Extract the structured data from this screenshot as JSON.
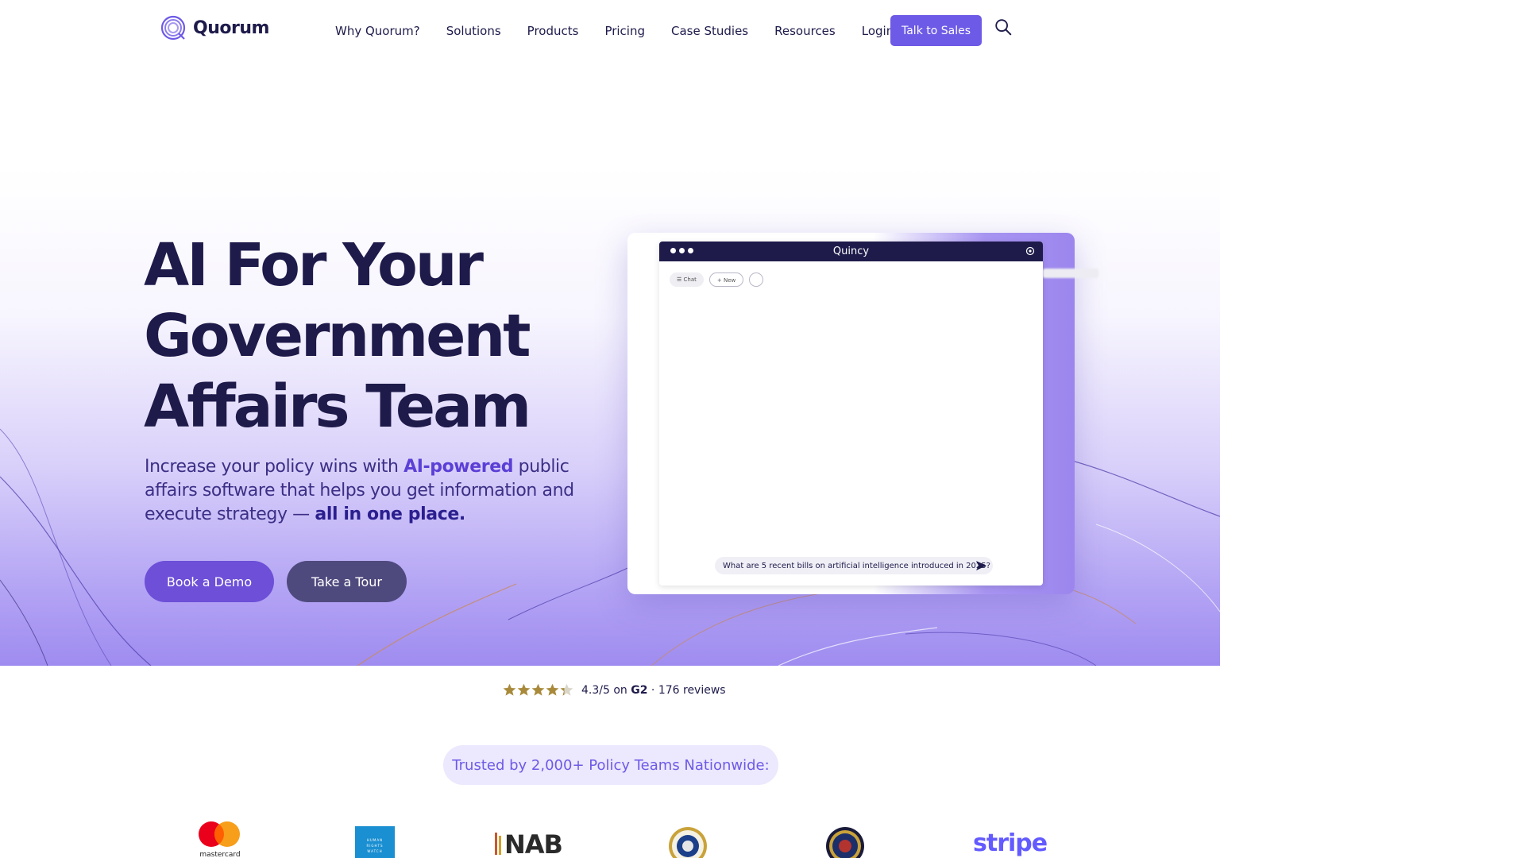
{
  "brand": {
    "name": "Quorum"
  },
  "nav": {
    "links": [
      "Why Quorum?",
      "Solutions",
      "Products",
      "Pricing",
      "Case Studies",
      "Resources",
      "Login"
    ],
    "cta_label": "Talk to Sales",
    "search_icon": "search-icon"
  },
  "hero": {
    "headline_lines": [
      "AI For Your",
      "Government",
      "Affairs Team"
    ],
    "subhead": {
      "part1": "Increase your policy wins with ",
      "highlight1": "AI-powered",
      "part2": " public affairs software that helps you get information and execute strategy — ",
      "highlight2": "all in one place."
    },
    "primary_button": "Book a Demo",
    "secondary_button": "Take a Tour"
  },
  "mockup": {
    "window_title": "Quincy",
    "chat_label": "Chat",
    "new_label": "+ New",
    "prompt": "What are 5 recent bills on artificial intelligence introduced in 2025?"
  },
  "rating": {
    "score": "4.3/5",
    "on_text": " on ",
    "platform": "G2",
    "reviews": " · 176 reviews",
    "stars_filled": 4.3,
    "stars_total": 5
  },
  "trusted": {
    "text": "Trusted by 2,000+ Policy Teams Nationwide:"
  },
  "logos": {
    "mastercard": "mastercard",
    "nab": "NAB",
    "stripe": "stripe",
    "hrw_lines": [
      "HUMAN",
      "RIGHTS",
      "WATCH"
    ]
  },
  "colors": {
    "navy": "#1e1b4b",
    "accent": "#6d5ae6",
    "purple_button": "#6d4fd8",
    "tour_button": "#4f4a7e",
    "star_gold": "#a88a3a"
  }
}
